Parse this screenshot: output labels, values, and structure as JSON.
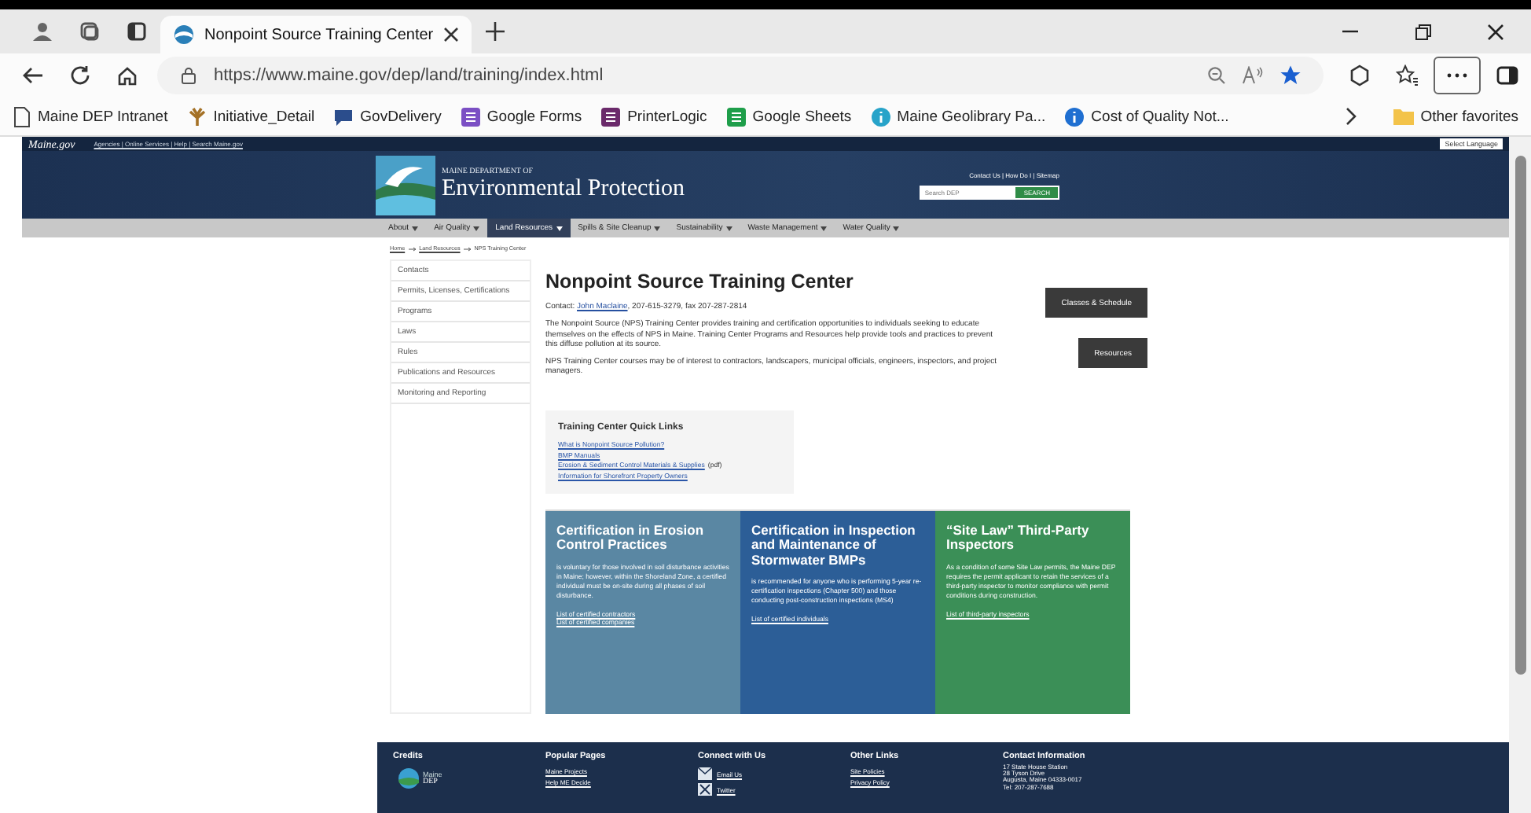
{
  "browser": {
    "tab": {
      "title": "Nonpoint Source Training Center",
      "selected": true
    },
    "url": "https://www.maine.gov/dep/land/training/index.html",
    "bookmarks": [
      {
        "kind": "page",
        "label": "Maine DEP Intranet"
      },
      {
        "kind": "plant",
        "label": "Initiative_Detail"
      },
      {
        "kind": "chat",
        "label": "GovDelivery"
      },
      {
        "kind": "forms",
        "label": "Google Forms"
      },
      {
        "kind": "printer",
        "label": "PrinterLogic"
      },
      {
        "kind": "sheets",
        "label": "Google Sheets"
      },
      {
        "kind": "geo",
        "label": "Maine Geolibrary Pa..."
      },
      {
        "kind": "info",
        "label": "Cost of Quality Not..."
      }
    ],
    "other_favorites": "Other favorites"
  },
  "topbar": {
    "logo": "Maine.gov",
    "links": "Agencies | Online Services | Help | Search Maine.gov",
    "language": "Select Language"
  },
  "header": {
    "dept": "MAINE DEPARTMENT OF",
    "title": "Environmental Protection",
    "links": "Contact Us | How Do I | Sitemap",
    "search_placeholder": "Search DEP",
    "search_button": "SEARCH"
  },
  "nav": [
    {
      "label": "About",
      "selected": false
    },
    {
      "label": "Air Quality",
      "selected": false
    },
    {
      "label": "Land Resources",
      "selected": true
    },
    {
      "label": "Spills & Site Cleanup",
      "selected": false
    },
    {
      "label": "Sustainability",
      "selected": false
    },
    {
      "label": "Waste Management",
      "selected": false
    },
    {
      "label": "Water Quality",
      "selected": false
    }
  ],
  "breadcrumb": [
    "Home",
    "Land Resources",
    "NPS Training Center"
  ],
  "sidebar": [
    "Contacts",
    "Permits, Licenses, Certifications",
    "Programs",
    "Laws",
    "Rules",
    "Publications and Resources",
    "Monitoring and Reporting"
  ],
  "main": {
    "title": "Nonpoint Source Training Center",
    "contact": {
      "prefix": "Contact: ",
      "name": "John Maclaine",
      "suffix": ", 207-615-3279, fax 207-287-2814"
    },
    "paragraphs": [
      "The Nonpoint Source (NPS) Training Center provides training and certification opportunities to individuals seeking to educate themselves on the effects of NPS in Maine. Training Center Programs and Resources help provide tools and practices to prevent this diffuse pollution at its source.",
      "NPS Training Center courses may be of interest to contractors, landscapers, municipal officials, engineers, inspectors, and project managers."
    ],
    "buttons": [
      "Classes & Schedule",
      "Resources"
    ]
  },
  "quick_links": {
    "title": "Training Center Quick Links",
    "links": [
      {
        "label": "What is Nonpoint Source Pollution?"
      },
      {
        "label": "BMP Manuals"
      },
      {
        "label": "Erosion & Sediment Control Materials & Supplies",
        "note": "(pdf)"
      },
      {
        "label": "Information for Shorefront Property Owners"
      }
    ]
  },
  "cards": [
    {
      "title": "Certification in Erosion Control Practices",
      "color": "#5a87a3",
      "text": "is voluntary for those involved in soil disturbance activities in Maine; however, within the Shoreland Zone, a certified individual must be on-site during all phases of soil disturbance.",
      "links": [
        "List of certified contractors",
        "List of certified companies"
      ]
    },
    {
      "title": "Certification in Inspection and Maintenance of Stormwater BMPs",
      "color": "#2c5e97",
      "text": "is recommended for anyone who is performing 5-year re-certification inspections (Chapter 500) and those conducting post-construction inspections (MS4)",
      "links": [
        "List of certified individuals"
      ]
    },
    {
      "title": "“Site Law” Third-Party Inspectors",
      "color": "#3b8f57",
      "text": "As a condition of some Site Law permits, the Maine DEP requires the permit applicant to retain the services of a third-party inspector to monitor compliance with permit conditions during construction.",
      "links": [
        "List of third-party inspectors"
      ]
    }
  ],
  "footer": [
    {
      "kind": "logo",
      "heading": "Credits",
      "items": [
        "Maine",
        "DEP"
      ]
    },
    {
      "kind": "links",
      "heading": "Popular Pages",
      "items": [
        "Maine Projects",
        "Help ME Decide"
      ]
    },
    {
      "kind": "social",
      "heading": "Connect with Us",
      "items": [
        "Email Us",
        "Twitter"
      ]
    },
    {
      "kind": "links",
      "heading": "Other Links",
      "items": [
        "Site Policies",
        "Privacy Policy"
      ]
    },
    {
      "kind": "address",
      "heading": "Contact Information",
      "items": [
        "17 State House Station",
        "28 Tyson Drive",
        "Augusta, Maine 04333-0017",
        "Tel: 207-287-7688"
      ]
    }
  ]
}
